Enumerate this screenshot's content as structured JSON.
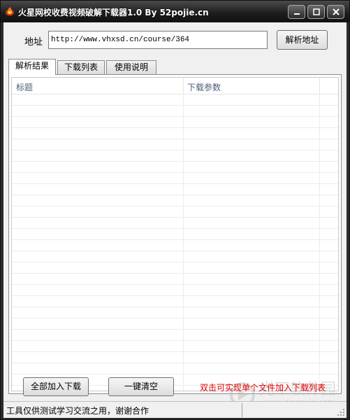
{
  "window": {
    "title": "火星网校收费视频破解下载器1.0 By 52pojie.cn",
    "controls": {
      "minimize": "minimize-icon",
      "maximize": "maximize-icon",
      "close": "close-icon"
    }
  },
  "address": {
    "label": "地址",
    "value": "http://www.vhxsd.cn/course/364",
    "parse_button": "解析地址"
  },
  "tabs": [
    {
      "label": "解析结果",
      "active": true
    },
    {
      "label": "下载列表",
      "active": false
    },
    {
      "label": "使用说明",
      "active": false
    }
  ],
  "table": {
    "columns": [
      "标题",
      "下载参数"
    ],
    "rows": []
  },
  "actions": {
    "add_all": "全部加入下载",
    "clear": "一键清空",
    "hint": "双击可实现单个文件加入下载列表"
  },
  "status": {
    "text": "工具仅供测试学习交流之用，谢谢合作"
  },
  "watermark": {
    "text": "光下软件园",
    "url": "www.downxia.com"
  },
  "colors": {
    "hint": "#e00000",
    "titlebar": "#1c1c1c",
    "header_text": "#4c607a"
  }
}
